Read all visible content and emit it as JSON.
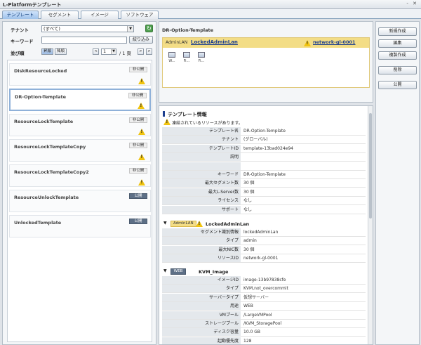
{
  "window": {
    "title": "L-Platformテンプレート",
    "controls": "- ✕"
  },
  "tabs": [
    "テンプレート",
    "セグメント",
    "イメージ",
    "ソフトウェア"
  ],
  "left": {
    "tenant_label": "テナント",
    "tenant_value": "(すべて)",
    "keyword_label": "キーワード",
    "filter_button": "絞り込み",
    "sort_label": "並び順",
    "sort_options": [
      "昇順",
      "降順"
    ],
    "page_current": "1",
    "page_total": "/ 1 頁",
    "items": [
      {
        "name": "DiskResourceLocked",
        "status": "非公開",
        "warn": true
      },
      {
        "name": "DR-Option-Template",
        "status": "非公開",
        "warn": true
      },
      {
        "name": "ResourceLockTemplate",
        "status": "非公開",
        "warn": true
      },
      {
        "name": "ResourceLockTemplateCopy",
        "status": "非公開",
        "warn": true
      },
      {
        "name": "ResourceLockTemplateCopy2",
        "status": "非公開",
        "warn": true
      },
      {
        "name": "ResourceUnlockTemplate",
        "status": "公開",
        "warn": false
      },
      {
        "name": "UnlockedTemplate",
        "status": "公開",
        "warn": false
      }
    ]
  },
  "diagram": {
    "header": "DR-Option-Template",
    "lan_tag": "AdminLAN",
    "lan_name": "LockedAdminLan",
    "network": "network-gl-0001",
    "vms": [
      "W...",
      "Fi...",
      "Fi..."
    ]
  },
  "info": {
    "section_title": "テンプレート情報",
    "warning": "凍結されているリソースがあります。",
    "template_rows": [
      {
        "k": "テンプレート名",
        "v": "DR-Option-Template"
      },
      {
        "k": "テナント",
        "v": "(グローバル)"
      },
      {
        "k": "テンプレートID",
        "v": "template-13bad024e94"
      },
      {
        "k": "説明",
        "v": ""
      },
      {
        "k": "",
        "v": ""
      },
      {
        "k": "キーワード",
        "v": "DR-Option-Template"
      },
      {
        "k": "最大セグメント数",
        "v": "30 個"
      },
      {
        "k": "最大L-Server数",
        "v": "30 個"
      },
      {
        "k": "ライセンス",
        "v": "なし"
      },
      {
        "k": "サポート",
        "v": "なし"
      }
    ],
    "lan_tag": "AdminLAN",
    "lan_name": "LockedAdminLan",
    "lan_rows": [
      {
        "k": "セグメント識別情報",
        "v": "lockedAdminLan"
      },
      {
        "k": "タイプ",
        "v": "admin"
      },
      {
        "k": "最大NIC数",
        "v": "30 個"
      },
      {
        "k": "リソースID",
        "v": "network-gl-0001"
      }
    ],
    "server_tag": "WEB",
    "server_name": "KVM_Image",
    "server_rows": [
      {
        "k": "イメージID",
        "v": "image-13b97838cfe"
      },
      {
        "k": "タイプ",
        "v": "KVM,not_overcommit"
      },
      {
        "k": "サーバータイプ",
        "v": "仮想サーバー"
      },
      {
        "k": "用途",
        "v": "WEB"
      },
      {
        "k": "VMプール",
        "v": "/LargeVMPool"
      },
      {
        "k": "ストレージプール",
        "v": "/KVM_StoragePool"
      },
      {
        "k": "ディスク容量",
        "v": "10.0 GB"
      },
      {
        "k": "起動優先度",
        "v": "128"
      }
    ]
  },
  "actions": [
    "新規作成",
    "編集",
    "複製作成",
    "削除",
    "公開"
  ],
  "colors": {
    "warning": "#f1c40f",
    "lan_bar": "#f3dd86",
    "link": "#1d3f8f",
    "public_badge": "#5d6f86"
  }
}
